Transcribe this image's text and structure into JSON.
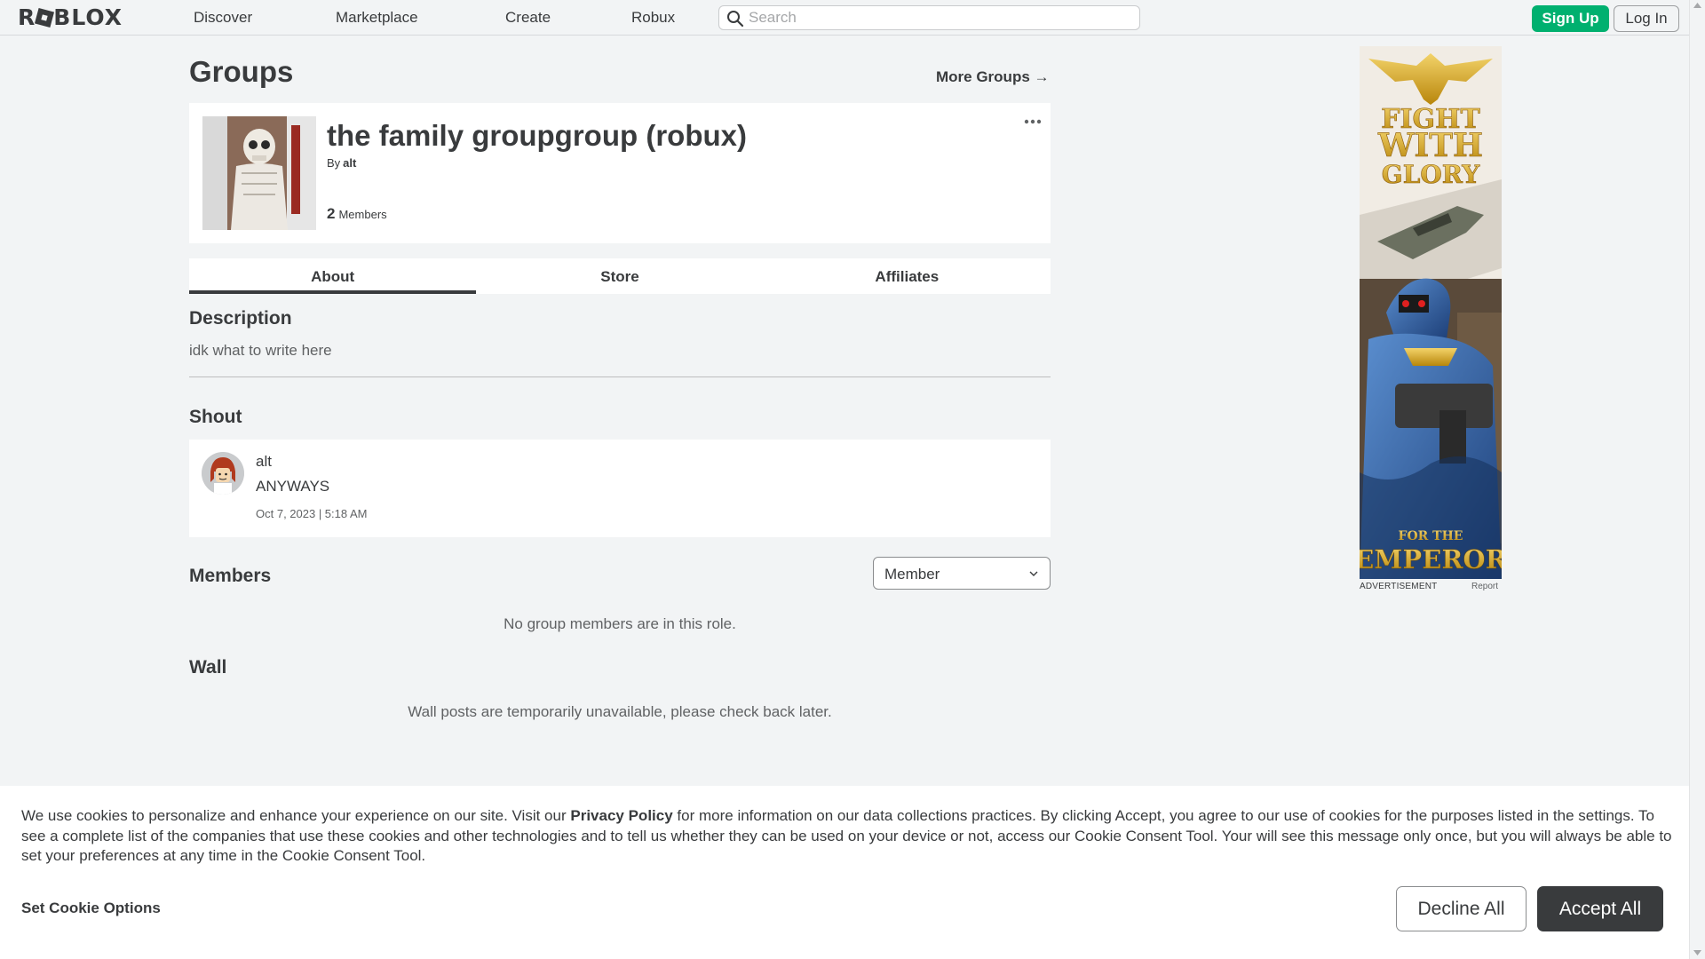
{
  "header": {
    "logo": "ROBLOX",
    "nav": [
      "Discover",
      "Marketplace",
      "Create",
      "Robux"
    ],
    "search_placeholder": "Search",
    "signup_label": "Sign Up",
    "login_label": "Log In"
  },
  "page": {
    "title": "Groups",
    "more_groups": "More Groups →"
  },
  "group": {
    "name": "the family groupgroup (robux)",
    "by_label": "By",
    "owner": "alt",
    "member_count": "2",
    "members_label": "Members"
  },
  "tabs": [
    "About",
    "Store",
    "Affiliates"
  ],
  "about": {
    "description_title": "Description",
    "description": "idk what to write here",
    "shout_title": "Shout",
    "shout": {
      "user": "alt",
      "message": "ANYWAYS",
      "date": "Oct 7, 2023 | 5:18 AM"
    },
    "members_title": "Members",
    "role_selected": "Member",
    "members_empty": "No group members are in this role.",
    "wall_title": "Wall",
    "wall_empty": "Wall posts are temporarily unavailable, please check back later."
  },
  "ad": {
    "label": "ADVERTISEMENT",
    "report": "Report",
    "headline_1": "FIGHT",
    "headline_2": "WITH",
    "headline_3": "GLORY",
    "footer_small": "FOR THE",
    "footer_big": "EMPEROR"
  },
  "cookie": {
    "text_before": "We use cookies to personalize and enhance your experience on our site. Visit our",
    "link": "Privacy Policy",
    "text_after": "for more information on our data collections practices. By clicking Accept, you agree to our use of cookies for the purposes listed in the settings. To see a complete list of the companies that use these cookies and other technologies and to tell us whether they can be used on your device or not, access our Cookie Consent Tool. Your will see this message only once, but you will always be able to set your preferences at any time in the Cookie Consent Tool.",
    "options": "Set Cookie Options",
    "decline": "Decline All",
    "accept": "Accept All"
  },
  "colors": {
    "background": "#f2f4f5",
    "signup_green": "#00b06f",
    "text": "#393b3d",
    "accept_dark": "#393b3d"
  }
}
